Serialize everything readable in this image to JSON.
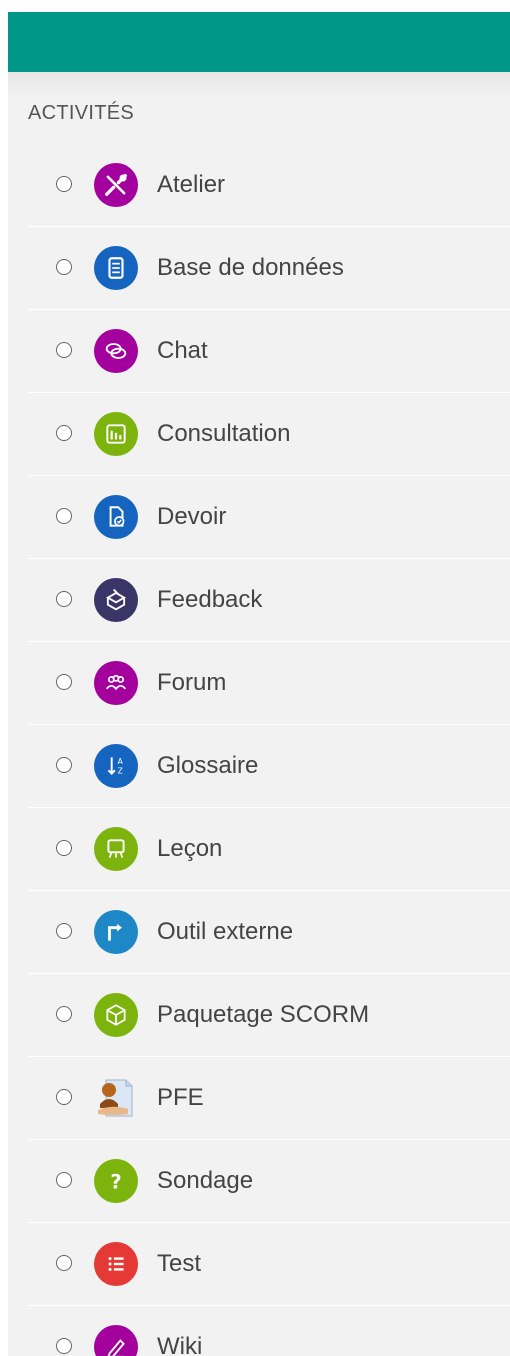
{
  "section": {
    "title": "ACTIVITÉS"
  },
  "colors": {
    "header": "#009688",
    "panel": "#f2f2f2"
  },
  "activities": [
    {
      "label": "Atelier",
      "icon": "tools-icon",
      "color": "#a3009e"
    },
    {
      "label": "Base de données",
      "icon": "database-icon",
      "color": "#1565c0"
    },
    {
      "label": "Chat",
      "icon": "chat-icon",
      "color": "#a3009e"
    },
    {
      "label": "Consultation",
      "icon": "chart-icon",
      "color": "#7cb30d"
    },
    {
      "label": "Devoir",
      "icon": "assignment-icon",
      "color": "#1565c0"
    },
    {
      "label": "Feedback",
      "icon": "feedback-box-icon",
      "color": "#3a3567"
    },
    {
      "label": "Forum",
      "icon": "forum-icon",
      "color": "#a3009e"
    },
    {
      "label": "Glossaire",
      "icon": "glossary-icon",
      "color": "#1565c0"
    },
    {
      "label": "Leçon",
      "icon": "lesson-icon",
      "color": "#7cb30d"
    },
    {
      "label": "Outil externe",
      "icon": "external-tool-icon",
      "color": "#1e88c7"
    },
    {
      "label": "Paquetage SCORM",
      "icon": "scorm-package-icon",
      "color": "#7cb30d"
    },
    {
      "label": "PFE",
      "icon": "pfe-icon",
      "color": "#d9a66d"
    },
    {
      "label": "Sondage",
      "icon": "survey-icon",
      "color": "#7cb30d"
    },
    {
      "label": "Test",
      "icon": "test-icon",
      "color": "#e53935"
    },
    {
      "label": "Wiki",
      "icon": "wiki-icon",
      "color": "#a3009e"
    }
  ]
}
